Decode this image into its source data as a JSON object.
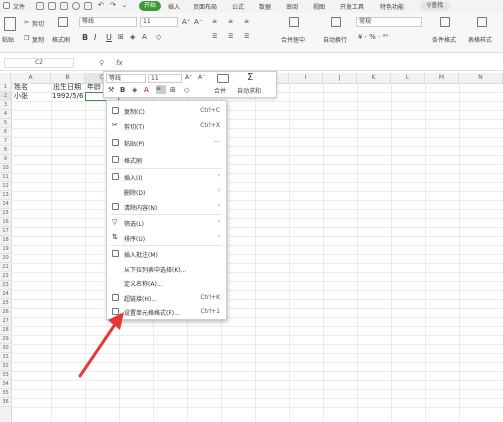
{
  "menubar": {
    "file": "文件",
    "tabs": [
      "开始",
      "插入",
      "页面布局",
      "公式",
      "数据",
      "审阅",
      "视图",
      "开发工具",
      "特色功能"
    ],
    "search": "查找"
  },
  "ribbon": {
    "paste": "粘贴",
    "cut": "剪切",
    "copy": "复制",
    "format_painter": "格式刷",
    "font_name": "等线",
    "font_size": "11",
    "bold": "B",
    "italic": "I",
    "underline": "U",
    "merge_center": "合并居中",
    "wrap_text": "自动换行",
    "number_format": "常规",
    "conditional_format": "条件格式",
    "table_style": "表格样式"
  },
  "formula_bar": {
    "name_box": "C2",
    "fx": "fx"
  },
  "columns": [
    "A",
    "B",
    "C",
    "D",
    "E",
    "F",
    "G",
    "H",
    "I",
    "J",
    "K",
    "L",
    "M",
    "N"
  ],
  "rows": [
    "1",
    "2",
    "3",
    "4",
    "5",
    "6",
    "7",
    "8",
    "9",
    "10",
    "11",
    "12",
    "13",
    "14",
    "15",
    "16",
    "17",
    "18",
    "19",
    "20",
    "21",
    "22",
    "23",
    "24",
    "25",
    "26",
    "27",
    "28",
    "29",
    "30",
    "31",
    "32",
    "33",
    "34",
    "35",
    "36"
  ],
  "cells": {
    "a1": "姓名",
    "b1": "出生日期",
    "c1": "年龄",
    "a2": "小张",
    "b2": "1992/5/6"
  },
  "mini_toolbar": {
    "font_name": "等线",
    "font_size": "11",
    "increase_font": "A⁺",
    "decrease_font": "A⁻",
    "merge": "合并",
    "autosum": "自动求和"
  },
  "context_menu": {
    "items": [
      {
        "label": "复制(C)",
        "shortcut": "Ctrl+C"
      },
      {
        "label": "剪切(T)",
        "shortcut": "Ctrl+X"
      },
      {
        "label": "粘贴(P)",
        "shortcut": "···"
      },
      {
        "label": "格式刷",
        "shortcut": ""
      },
      {
        "label": "插入(I)",
        "shortcut": "›"
      },
      {
        "label": "删除(D)",
        "shortcut": "›"
      },
      {
        "label": "清除内容(N)",
        "shortcut": "›"
      },
      {
        "label": "筛选(L)",
        "shortcut": "›"
      },
      {
        "label": "排序(U)",
        "shortcut": "›"
      },
      {
        "label": "插入批注(M)",
        "shortcut": ""
      },
      {
        "label": "从下拉列表中选择(K)...",
        "shortcut": ""
      },
      {
        "label": "定义名称(A)...",
        "shortcut": ""
      },
      {
        "label": "超链接(H)...",
        "shortcut": "Ctrl+K"
      },
      {
        "label": "设置单元格格式(F)...",
        "shortcut": "Ctrl+1"
      }
    ]
  },
  "colors": {
    "accent": "#3a9a3a",
    "arrow": "#e53935"
  }
}
